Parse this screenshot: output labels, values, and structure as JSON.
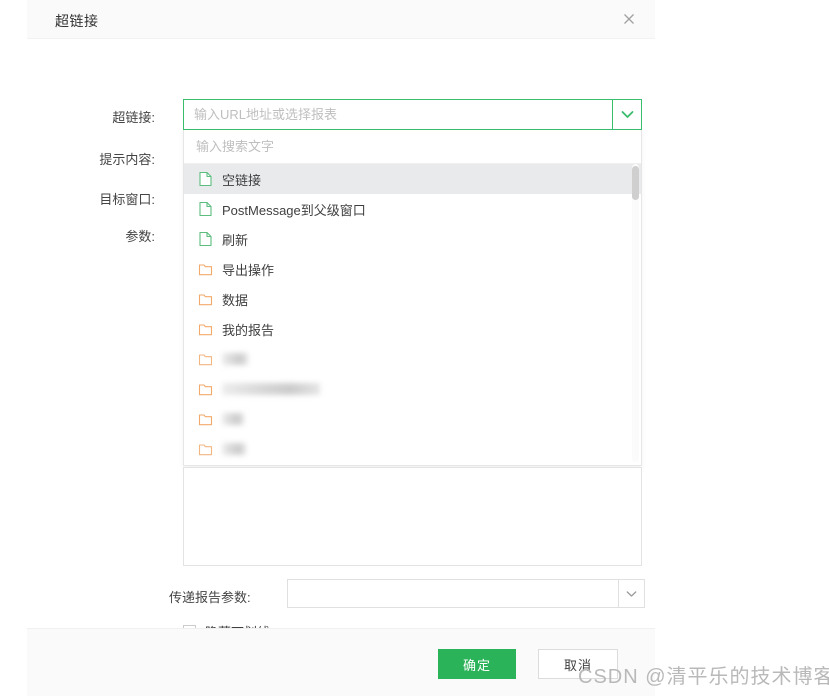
{
  "dialog": {
    "title": "超链接",
    "close_icon": "close-icon"
  },
  "fields": {
    "hyperlink_label": "超链接:",
    "tip_label": "提示内容:",
    "target_window_label": "目标窗口:",
    "params_label": "参数:",
    "pass_report_params_label": "传递报告参数:"
  },
  "hyperlink": {
    "value": "",
    "placeholder": "输入URL地址或选择报表",
    "arrow_icon": "chevron-down-icon"
  },
  "dropdown": {
    "search_placeholder": "输入搜索文字",
    "items": [
      {
        "label": "空链接",
        "icon": "file-icon",
        "icon_color": "#5cbd7f",
        "selected": true,
        "blurred": false
      },
      {
        "label": "PostMessage到父级窗口",
        "icon": "file-icon",
        "icon_color": "#5cbd7f",
        "selected": false,
        "blurred": false
      },
      {
        "label": "刷新",
        "icon": "file-icon",
        "icon_color": "#5cbd7f",
        "selected": false,
        "blurred": false
      },
      {
        "label": "导出操作",
        "icon": "folder-icon",
        "icon_color": "#f0a濡",
        "selected": false,
        "blurred": false
      },
      {
        "label": "数据",
        "icon": "folder-icon",
        "icon_color": "#f2a96a",
        "selected": false,
        "blurred": false
      },
      {
        "label": "我的报告",
        "icon": "folder-icon",
        "icon_color": "#f2a96a",
        "selected": false,
        "blurred": false
      },
      {
        "label": "",
        "icon": "folder-icon",
        "icon_color": "#f2a96a",
        "selected": false,
        "blurred": true,
        "blur_width": "b-w1"
      },
      {
        "label": "",
        "icon": "folder-icon",
        "icon_color": "#f2a96a",
        "selected": false,
        "blurred": true,
        "blur_width": "b-w2"
      },
      {
        "label": "",
        "icon": "folder-icon",
        "icon_color": "#f2a96a",
        "selected": false,
        "blurred": true,
        "blur_width": "b-w3"
      },
      {
        "label": "",
        "icon": "folder-icon",
        "icon_color": "#f2a96a",
        "selected": false,
        "blurred": true,
        "blur_width": "b-w4"
      }
    ]
  },
  "params_textarea": {
    "value": "",
    "placeholder": ""
  },
  "pass_report_params": {
    "value": "",
    "placeholder": "",
    "arrow_icon": "chevron-down-icon"
  },
  "hide_underline": {
    "label": "隐藏下划线",
    "checked": false
  },
  "footer": {
    "ok_label": "确定",
    "cancel_label": "取消"
  },
  "watermark": {
    "text": "CSDN @清平乐的技术博客"
  },
  "colors": {
    "accent_green": "#2bb35a",
    "focus_border_green": "#3bbd6e",
    "folder_orange": "#f2a96a",
    "file_green": "#5cbd7f"
  }
}
